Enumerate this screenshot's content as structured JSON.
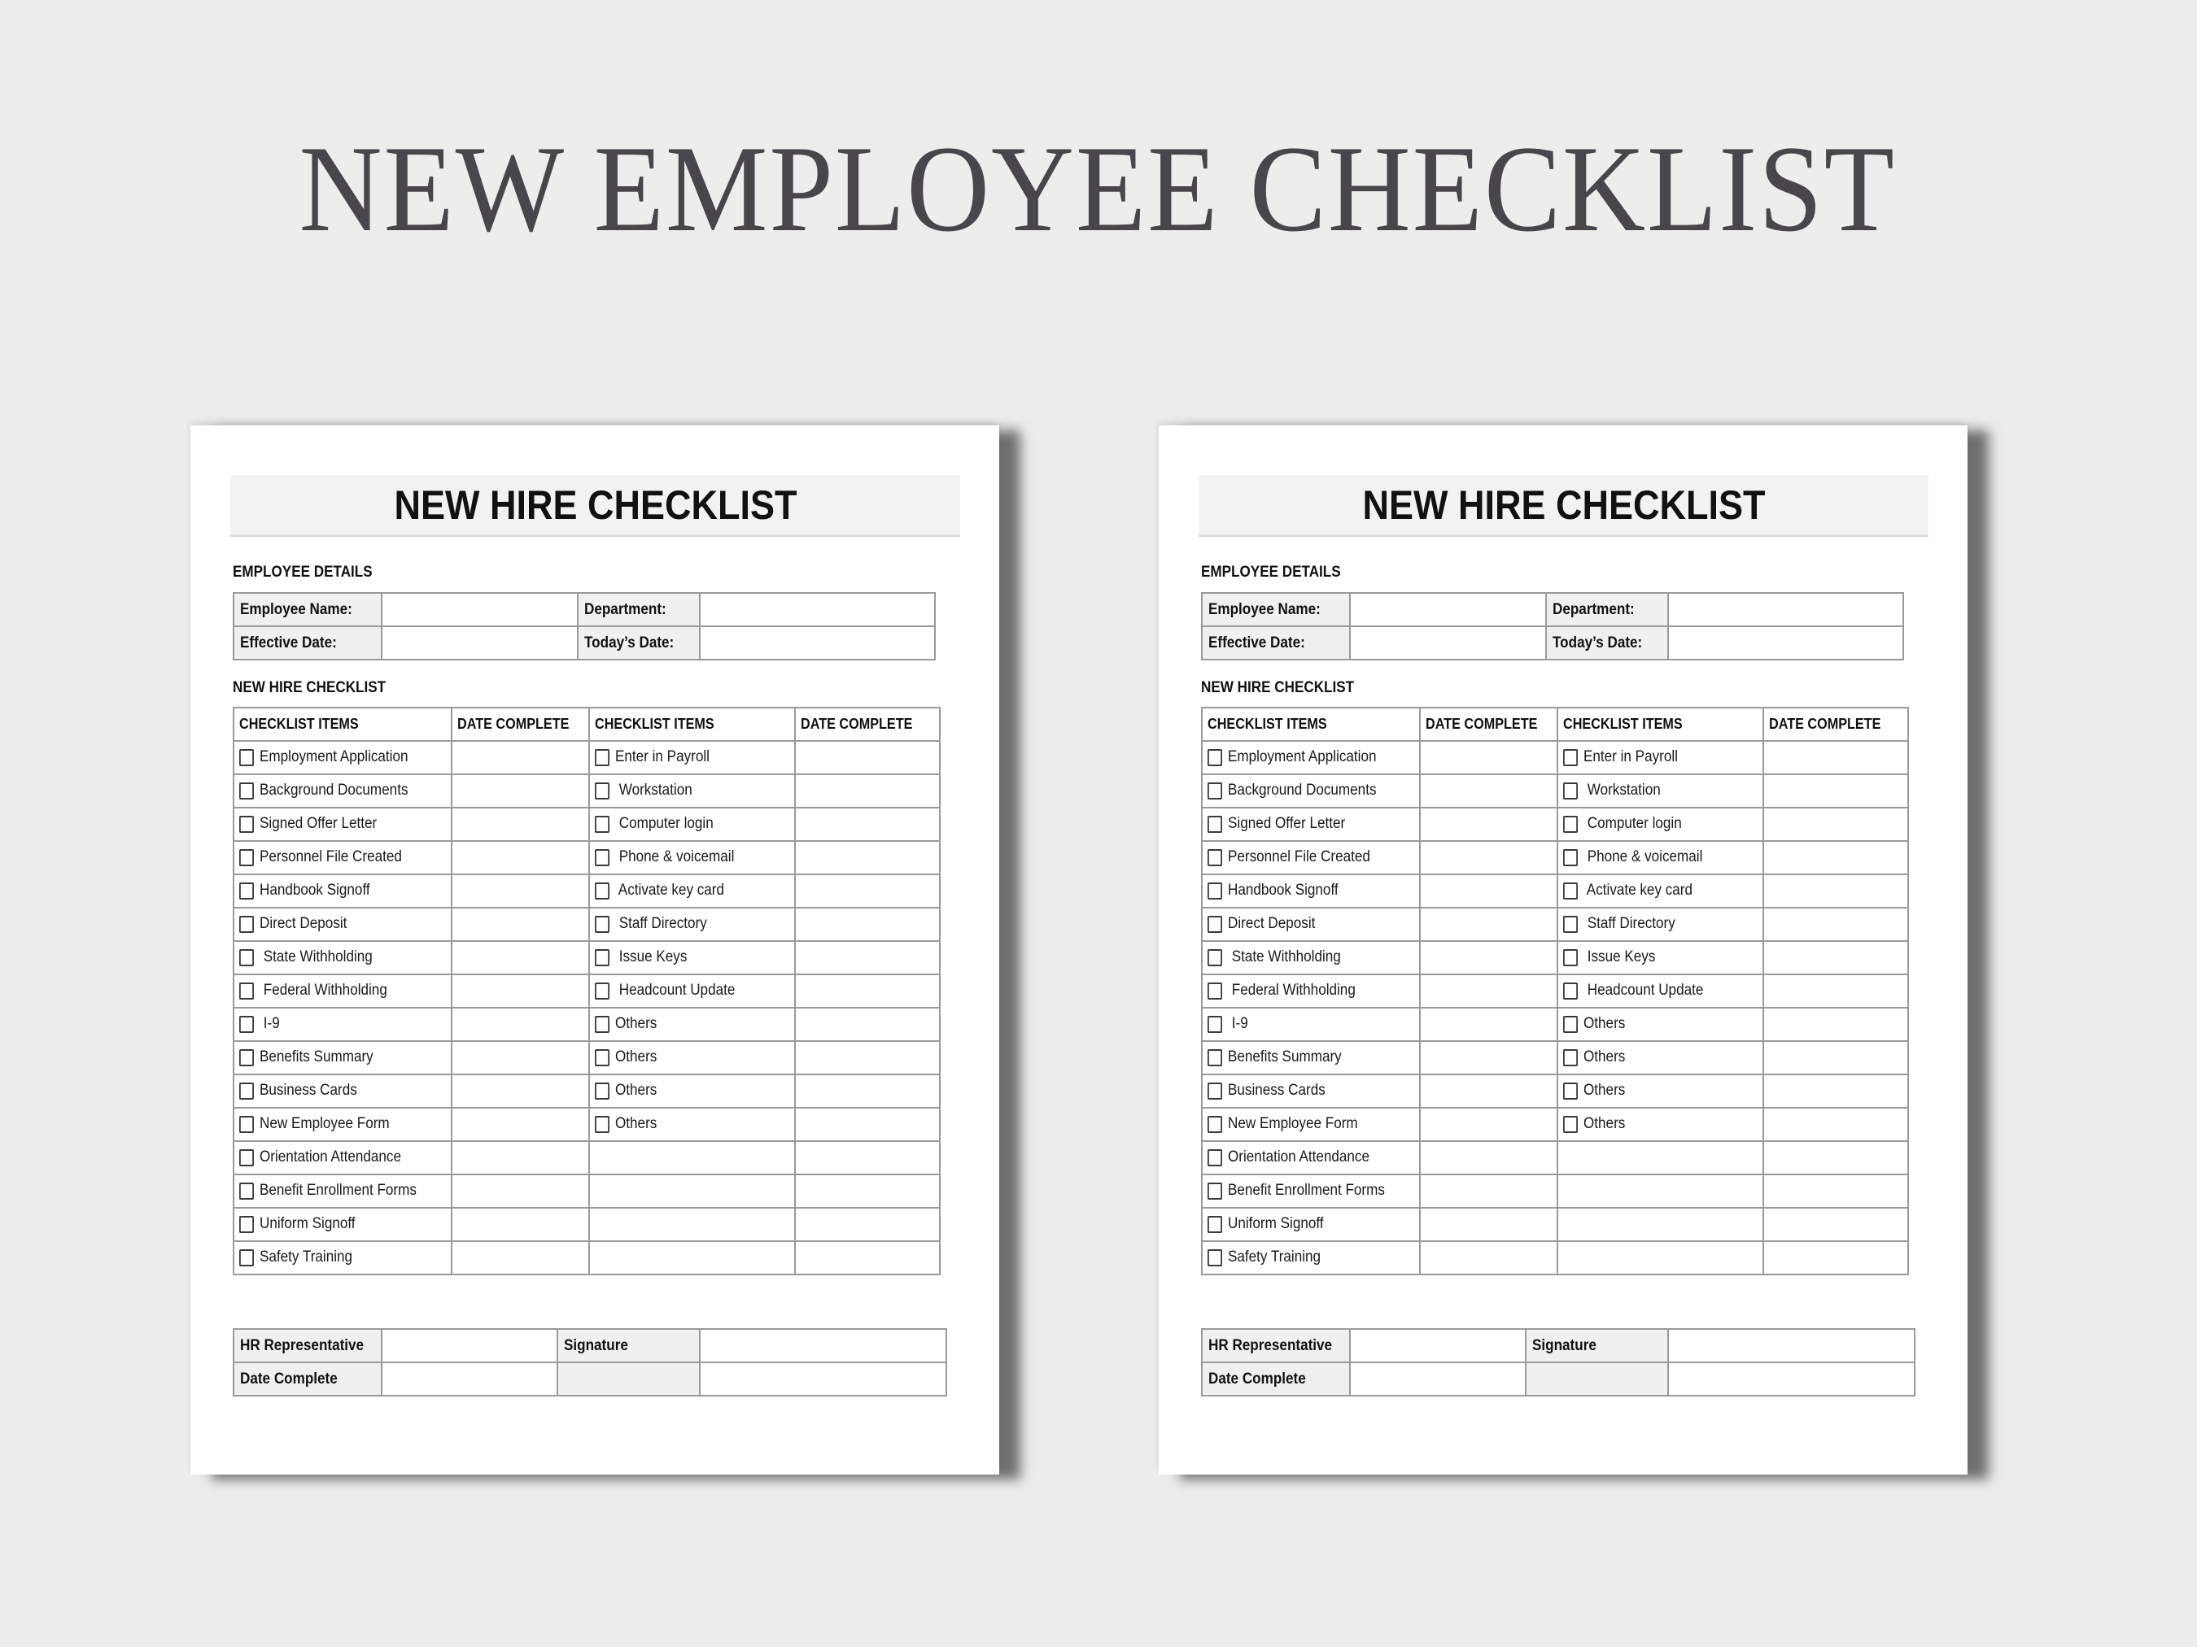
{
  "hero_title": "NEW EMPLOYEE CHECKLIST",
  "pages": [
    {
      "side": "left"
    },
    {
      "side": "right"
    }
  ],
  "form": {
    "title": "NEW HIRE CHECKLIST",
    "employee_section_label": "EMPLOYEE DETAILS",
    "employee_fields": {
      "employee_name_label": "Employee Name:",
      "employee_name_value": "",
      "department_label": "Department:",
      "department_value": "",
      "effective_date_label": "Effective Date:",
      "effective_date_value": "",
      "todays_date_label": "Today’s Date:",
      "todays_date_value": ""
    },
    "checklist_section_label": "NEW HIRE CHECKLIST",
    "checklist_headers": [
      "CHECKLIST ITEMS",
      "DATE COMPLETE",
      "CHECKLIST ITEMS",
      "DATE COMPLETE"
    ],
    "left_items": [
      "Employment Application",
      "Background Documents",
      "Signed Offer Letter",
      "Personnel File Created",
      "Handbook Signoff",
      "Direct Deposit",
      " State Withholding",
      " Federal Withholding",
      " I-9",
      "Benefits Summary",
      "Business Cards",
      "New Employee Form",
      "Orientation Attendance",
      "Benefit Enrollment Forms",
      "Uniform Signoff",
      "Safety Training"
    ],
    "right_items": [
      "Enter in Payroll",
      " Workstation",
      " Computer login",
      " Phone & voicemail",
      " Activate key card",
      " Staff Directory",
      " Issue Keys",
      " Headcount Update",
      "Others",
      "Others",
      "Others",
      "Others",
      null,
      null,
      null,
      null
    ],
    "signoff": {
      "hr_representative_label": "HR Representative",
      "signature_label": "Signature",
      "date_complete_label": "Date Complete"
    }
  },
  "colors": {
    "background": "#ededeb",
    "hero_text": "#48454b",
    "label_fill": "#f0f0f0",
    "grid_line": "#9a9a9a"
  }
}
